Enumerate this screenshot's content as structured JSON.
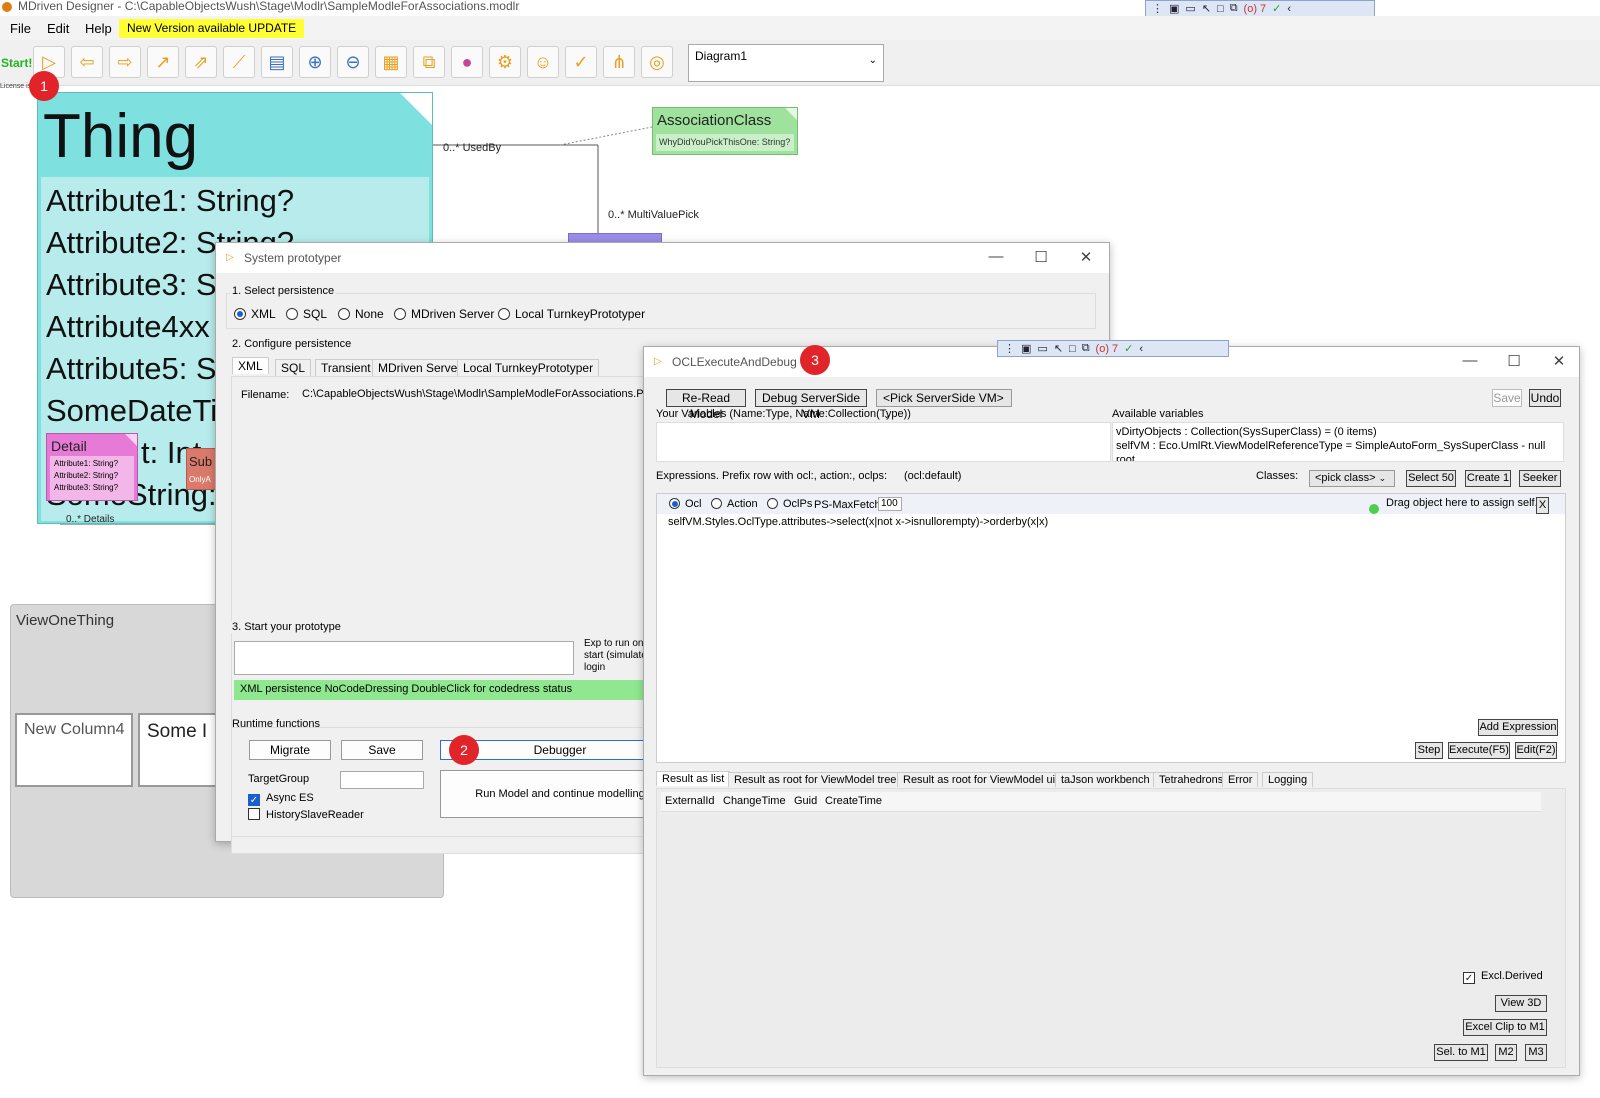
{
  "app": {
    "title": "MDriven Designer - C:\\CapableObjectsWush\\Stage\\Modlr\\SampleModleForAssociations.modlr",
    "menu": [
      "File",
      "Edit",
      "Help"
    ],
    "update_banner": "New Version available UPDATE",
    "start_label": "Start!",
    "license_text": "License is valid",
    "diagram_select": "Diagram1",
    "toolbar_icons": [
      "play-icon",
      "back-arrow-icon",
      "forward-arrow-icon",
      "association-arrow-icon",
      "inheritance-arrow-icon",
      "line-icon",
      "viewmodel-icon",
      "zoom-in-icon",
      "zoom-out-icon",
      "calendar-icon",
      "layers-icon",
      "color-wheel-icon",
      "settings-gear-icon",
      "user-link-icon",
      "check-circle-icon",
      "network-icon",
      "spinner-icon"
    ]
  },
  "overlay_toolbar": {
    "count_label": "(o) 7",
    "icons": [
      "grip-icon",
      "frame-select-icon",
      "camera-icon",
      "pointer-icon",
      "rect-icon",
      "multi-select-icon",
      "check-icon",
      "chevron-left-icon"
    ]
  },
  "badges": [
    "1",
    "2",
    "3"
  ],
  "diagram": {
    "thing": {
      "title": "Thing",
      "attrs": [
        "Attribute1: String?",
        "Attribute2: String?",
        "Attribute3: S",
        "Attribute4xx",
        "Attribute5: S",
        "SomeDateTi",
        "t: Int",
        "SomeString:"
      ]
    },
    "association_class": {
      "title": "AssociationClass",
      "attr": "WhyDidYouPickThisOne: String?"
    },
    "detail": {
      "title": "Detail",
      "attrs": [
        "Attribute1: String?",
        "Attribute2: String?",
        "Attribute3: String?"
      ]
    },
    "sub": {
      "title": "Sub",
      "attr": "OnlyA"
    },
    "labels": {
      "used_by": "0..* UsedBy",
      "multi_value_pick": "0..* MultiValuePick",
      "details": "0..* Details"
    }
  },
  "viewonething": {
    "title": "ViewOneThing",
    "columns": [
      "New Column4",
      "Some I"
    ]
  },
  "system_prototyper": {
    "title": "System prototyper",
    "section1": "1. Select persistence",
    "persistence_options": [
      "XML",
      "SQL",
      "None",
      "MDriven Server",
      "Local TurnkeyPrototyper"
    ],
    "selected_persistence": "XML",
    "section2": "2. Configure persistence",
    "config_tabs": [
      "XML",
      "SQL",
      "Transient",
      "MDriven Server",
      "Local TurnkeyPrototyper"
    ],
    "filename_label": "Filename:",
    "filename_value": "C:\\CapableObjectsWush\\Stage\\Modlr\\SampleModleForAssociations.Prot",
    "section3": "3. Start your prototype",
    "exp_label": "Exp to run on start (simulate login",
    "status": "XML persistence NoCodeDressing DoubleClick for codedress status",
    "runtime_label": "Runtime functions",
    "migrate": "Migrate",
    "save": "Save",
    "debugger": "Debugger",
    "target_group_label": "TargetGroup",
    "async_es": "Async ES",
    "history_slave": "HistorySlaveReader",
    "run_model": "Run Model and continue modelling"
  },
  "ocl_debug": {
    "title": "OCLExecuteAndDebug",
    "reread": "Re-Read Model",
    "debug_server": "Debug ServerSide VM",
    "pick_vm": "<Pick ServerSide VM>",
    "save": "Save",
    "undo": "Undo",
    "your_vars_label": "Your Variables (Name:Type, Name:Collection(Type))",
    "available_vars_label": "Available variables",
    "available_vars": [
      "vDirtyObjects : Collection(SysSuperClass) = (0 items)",
      "selfVM : Eco.UmlRt.ViewModelReferenceType = SimpleAutoForm_SysSuperClass - null",
      "root"
    ],
    "expressions_label": "Expressions. Prefix row with ocl:, action:, oclps:",
    "ocl_default": "(ocl:default)",
    "classes_label": "Classes:",
    "pick_class": "<pick class>",
    "select50": "Select 50",
    "create1": "Create 1",
    "seeker": "Seeker",
    "mode_options": [
      "Ocl",
      "Action",
      "OclPs"
    ],
    "selected_mode": "Ocl",
    "ps_maxfetch_label": "PS-MaxFetch",
    "ps_maxfetch_value": "100",
    "drag_hint": "Drag object here to assign self.",
    "close_x": "X",
    "expression": "selfVM.Styles.OclType.attributes->select(x|not x->isnullorempty)->orderby(x|x)",
    "add_expression": "Add Expression",
    "step": "Step",
    "execute": "Execute(F5)",
    "edit": "Edit(F2)",
    "result_tabs": [
      "Result as list",
      "Result as root for ViewModel tree",
      "Result as root for ViewModel ui",
      "taJson workbench",
      "Tetrahedrons",
      "Error",
      "Logging"
    ],
    "columns": [
      "ExternalId",
      "ChangeTime",
      "Guid",
      "CreateTime"
    ],
    "excl_derived": "Excl.Derived",
    "view3d": "View 3D",
    "excel_clip": "Excel Clip to M1",
    "sel_to_m1": "Sel. to M1",
    "m2": "M2",
    "m3": "M3"
  }
}
